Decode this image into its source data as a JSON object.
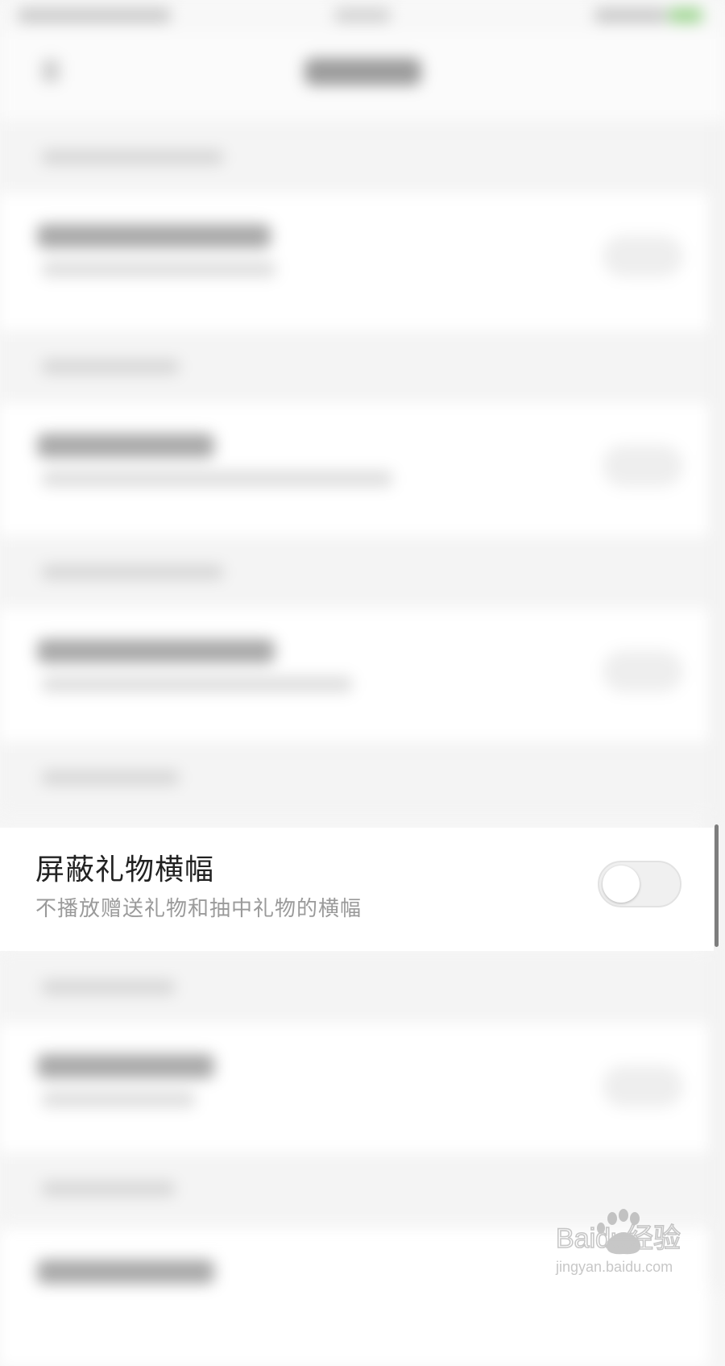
{
  "setting_row": {
    "title": "屏蔽礼物横幅",
    "subtitle": "不播放赠送礼物和抽中礼物的横幅",
    "toggle_on": false
  },
  "watermark": {
    "logo": "Baidu经验",
    "url": "jingyan.baidu.com"
  },
  "colors": {
    "background": "#f6f6f6",
    "row_background": "#ffffff",
    "title_text": "#222222",
    "subtitle_text": "#9a9a9a",
    "toggle_off": "#f0f0f0"
  }
}
